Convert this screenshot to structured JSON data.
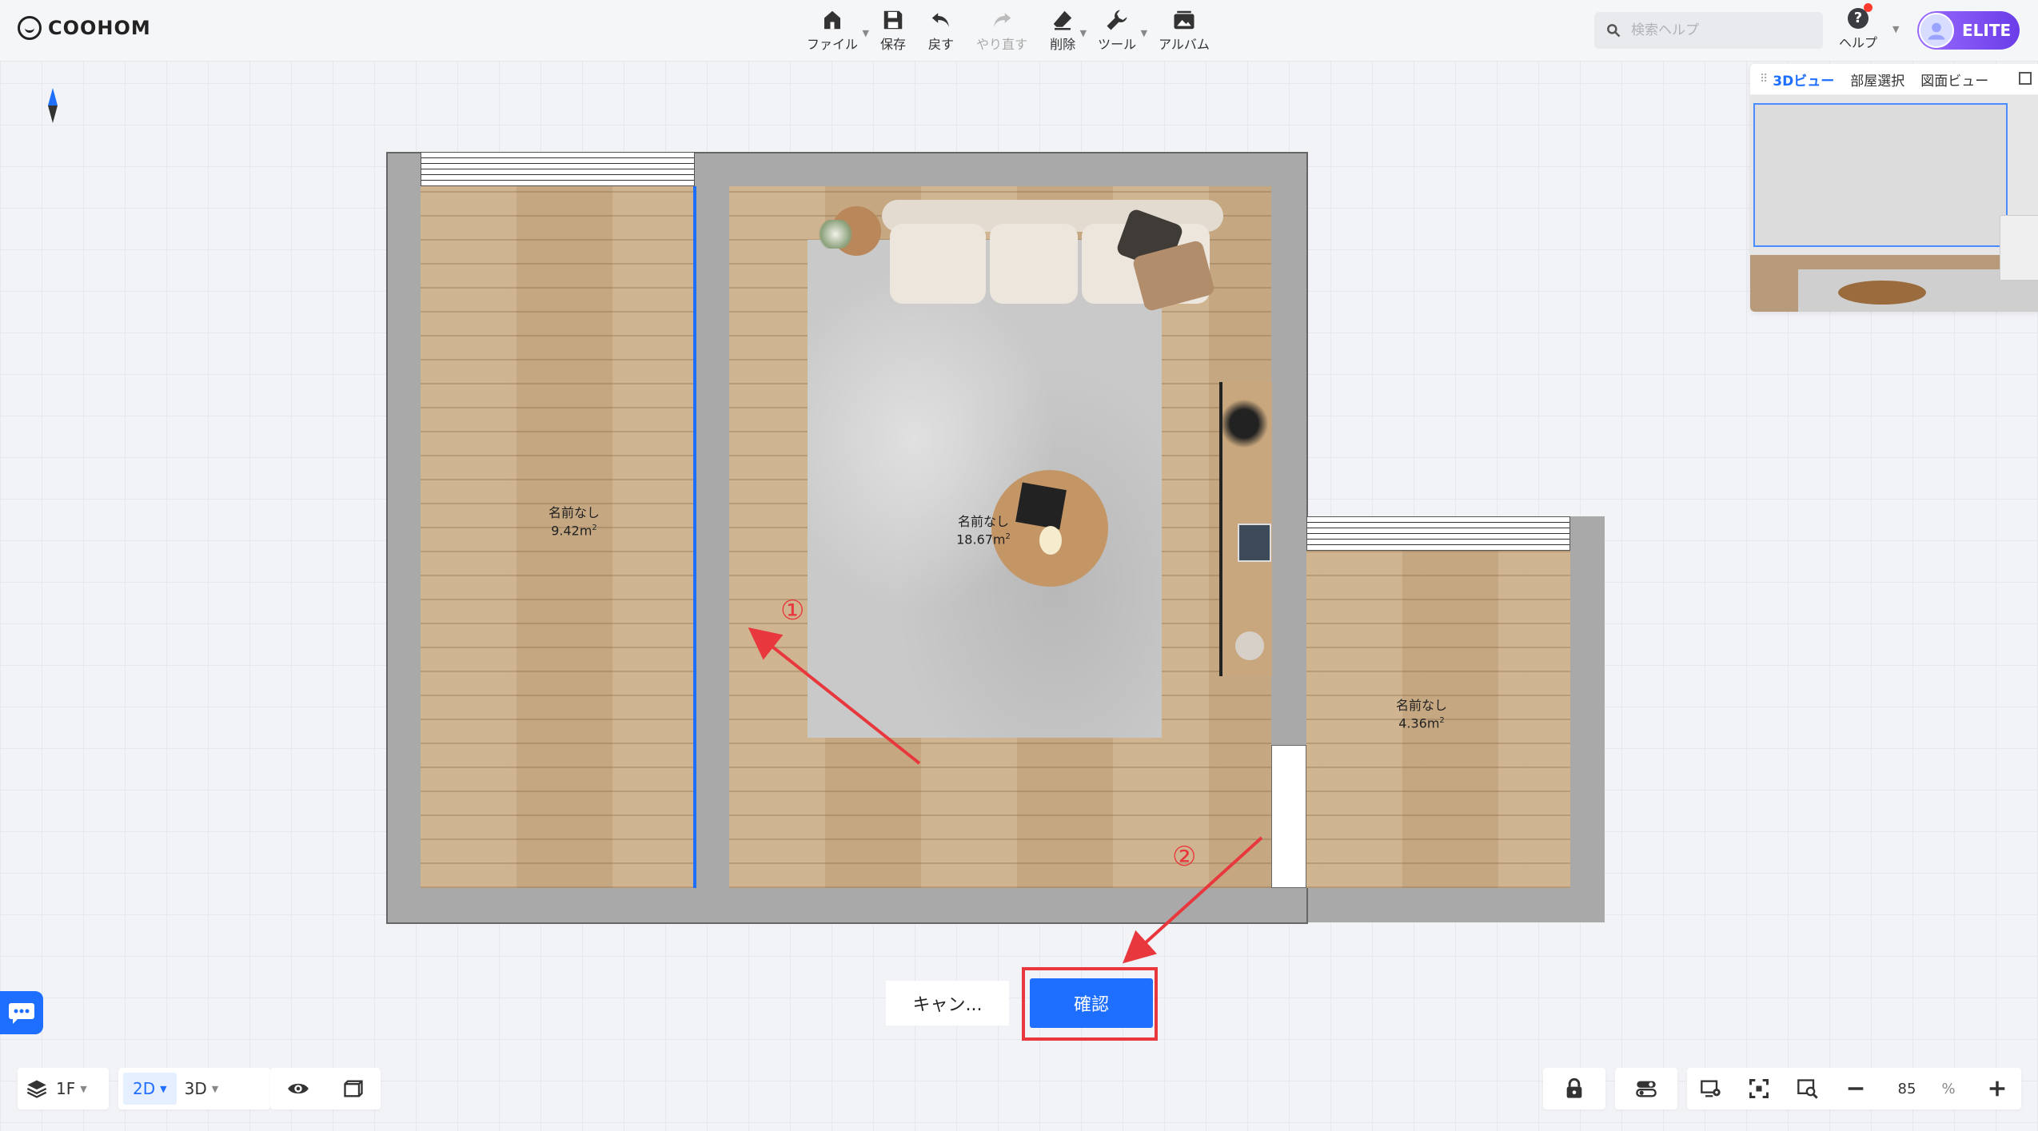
{
  "app": {
    "logo_text": "COOHOM"
  },
  "toolbar": {
    "file": "ファイル",
    "save": "保存",
    "undo": "戻す",
    "redo": "やり直す",
    "delete": "削除",
    "tools": "ツール",
    "album": "アルバム"
  },
  "search": {
    "placeholder": "検索ヘルプ"
  },
  "help": {
    "label": "ヘルプ"
  },
  "user": {
    "badge": "ELITE"
  },
  "preview": {
    "tabs": [
      "3Dビュー",
      "部屋選択",
      "図面ビュー"
    ],
    "active_tab": "3Dビュー"
  },
  "rooms": [
    {
      "name": "名前なし",
      "area": "9.42m",
      "area_unit": "2"
    },
    {
      "name": "名前なし",
      "area": "18.67m",
      "area_unit": "2"
    },
    {
      "name": "名前なし",
      "area": "4.36m",
      "area_unit": "2"
    }
  ],
  "annotations": {
    "step1": "①",
    "step2": "②"
  },
  "dialog": {
    "cancel": "キャン...",
    "confirm": "確認"
  },
  "bottom": {
    "floor": "1F",
    "mode_2d": "2D",
    "mode_3d": "3D",
    "zoom_value": "85",
    "zoom_unit": "%"
  },
  "colors": {
    "accent": "#1e6fff",
    "highlight": "#e8383d",
    "wall": "#a9a9a9"
  }
}
